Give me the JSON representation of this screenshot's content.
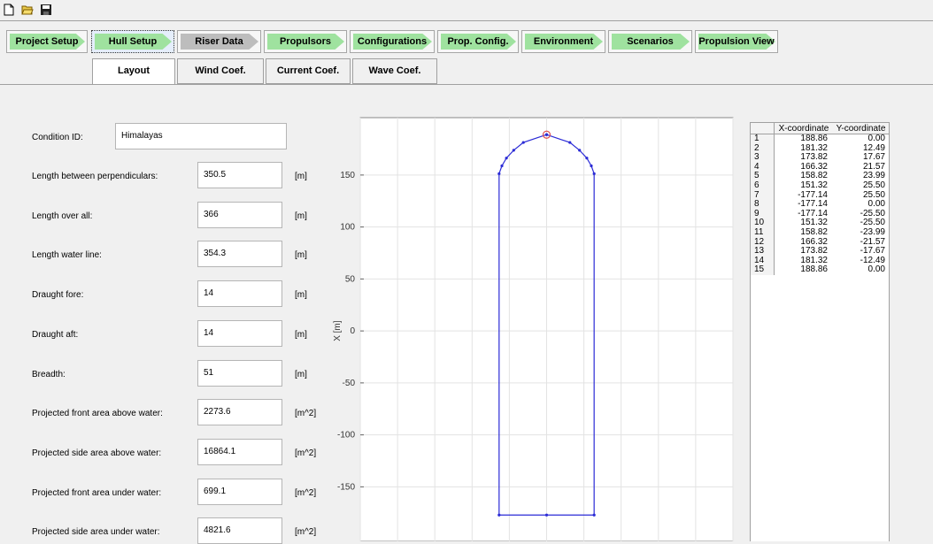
{
  "toolbar": {
    "icons": [
      "new-file-icon",
      "open-folder-icon",
      "save-icon"
    ]
  },
  "workflow": {
    "steps": [
      {
        "label": "Project Setup",
        "color": "#9fe29f"
      },
      {
        "label": "Hull Setup",
        "color": "#9fe29f",
        "selected": true
      },
      {
        "label": "Riser Data",
        "color": "#bdbdbd"
      },
      {
        "label": "Propulsors",
        "color": "#9fe29f"
      },
      {
        "label": "Configurations",
        "color": "#9fe29f"
      },
      {
        "label": "Prop. Config.",
        "color": "#9fe29f"
      },
      {
        "label": "Environment",
        "color": "#9fe29f"
      },
      {
        "label": "Scenarios",
        "color": "#9fe29f"
      },
      {
        "label": "Propulsion View",
        "color": "#9fe29f"
      }
    ]
  },
  "subtabs": [
    {
      "label": "Layout",
      "active": true
    },
    {
      "label": "Wind Coef."
    },
    {
      "label": "Current Coef."
    },
    {
      "label": "Wave Coef."
    }
  ],
  "form": {
    "condition_label": "Condition ID:",
    "condition_value": "Himalayas",
    "fields": [
      {
        "label": "Length between perpendiculars:",
        "value": "350.5",
        "unit": "[m]"
      },
      {
        "label": "Length over all:",
        "value": "366",
        "unit": "[m]"
      },
      {
        "label": "Length water line:",
        "value": "354.3",
        "unit": "[m]"
      },
      {
        "label": "Draught fore:",
        "value": "14",
        "unit": "[m]"
      },
      {
        "label": "Draught aft:",
        "value": "14",
        "unit": "[m]"
      },
      {
        "label": "Breadth:",
        "value": "51",
        "unit": "[m]"
      },
      {
        "label": "Projected front area above water:",
        "value": "2273.6",
        "unit": "[m^2]"
      },
      {
        "label": "Projected side area above water:",
        "value": "16864.1",
        "unit": "[m^2]"
      },
      {
        "label": "Projected front area under water:",
        "value": "699.1",
        "unit": "[m^2]"
      },
      {
        "label": "Projected side area under water:",
        "value": "4821.6",
        "unit": "[m^2]"
      }
    ]
  },
  "chart_data": {
    "type": "line",
    "title": "",
    "xlabel": "",
    "ylabel": "X [m]",
    "x_range": [
      -100,
      100
    ],
    "ylim": [
      -185,
      195
    ],
    "y_ticks": [
      150,
      100,
      50,
      0,
      -50,
      -100,
      -150
    ],
    "grid": true,
    "line_color": "#2b2bd6",
    "highlight_point_color": "#e05050",
    "series": [
      {
        "points": [
          {
            "x": 0.0,
            "y": 188.86
          },
          {
            "x": 12.49,
            "y": 181.32
          },
          {
            "x": 17.67,
            "y": 173.82
          },
          {
            "x": 21.57,
            "y": 166.32
          },
          {
            "x": 23.99,
            "y": 158.82
          },
          {
            "x": 25.5,
            "y": 151.32
          },
          {
            "x": 25.5,
            "y": -177.14
          },
          {
            "x": 0.0,
            "y": -177.14
          },
          {
            "x": -25.5,
            "y": -177.14
          },
          {
            "x": -25.5,
            "y": 151.32
          },
          {
            "x": -23.99,
            "y": 158.82
          },
          {
            "x": -21.57,
            "y": 166.32
          },
          {
            "x": -17.67,
            "y": 173.82
          },
          {
            "x": -12.49,
            "y": 181.32
          },
          {
            "x": 0.0,
            "y": 188.86
          }
        ]
      }
    ]
  },
  "coord_table": {
    "headers": [
      "X-coordinate",
      "Y-coordinate"
    ],
    "rows": [
      {
        "idx": "1",
        "x": "188.86",
        "y": "0.00"
      },
      {
        "idx": "2",
        "x": "181.32",
        "y": "12.49"
      },
      {
        "idx": "3",
        "x": "173.82",
        "y": "17.67"
      },
      {
        "idx": "4",
        "x": "166.32",
        "y": "21.57"
      },
      {
        "idx": "5",
        "x": "158.82",
        "y": "23.99"
      },
      {
        "idx": "6",
        "x": "151.32",
        "y": "25.50"
      },
      {
        "idx": "7",
        "x": "-177.14",
        "y": "25.50"
      },
      {
        "idx": "8",
        "x": "-177.14",
        "y": "0.00"
      },
      {
        "idx": "9",
        "x": "-177.14",
        "y": "-25.50"
      },
      {
        "idx": "10",
        "x": "151.32",
        "y": "-25.50"
      },
      {
        "idx": "11",
        "x": "158.82",
        "y": "-23.99"
      },
      {
        "idx": "12",
        "x": "166.32",
        "y": "-21.57"
      },
      {
        "idx": "13",
        "x": "173.82",
        "y": "-17.67"
      },
      {
        "idx": "14",
        "x": "181.32",
        "y": "-12.49"
      },
      {
        "idx": "15",
        "x": "188.86",
        "y": "0.00"
      }
    ]
  }
}
